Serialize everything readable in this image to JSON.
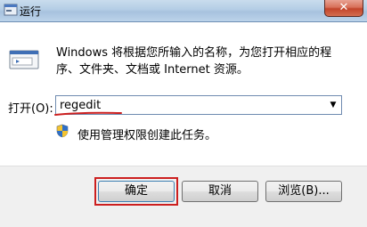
{
  "window": {
    "title": "运行",
    "close_glyph": "✕"
  },
  "description": "Windows 将根据您所输入的名称，为您打开相应的程序、文件夹、文档或 Internet 资源。",
  "open": {
    "label": "打开(O):",
    "value": "regedit"
  },
  "admin_note": "使用管理权限创建此任务。",
  "buttons": {
    "ok": "确定",
    "cancel": "取消",
    "browse": "浏览(B)..."
  },
  "colors": {
    "highlight": "#cc1f1f",
    "titlebar": "#b4cde5"
  },
  "icons": [
    "run-app-icon",
    "run-program-icon",
    "uac-shield-icon",
    "close-icon",
    "dropdown-arrow-icon"
  ]
}
